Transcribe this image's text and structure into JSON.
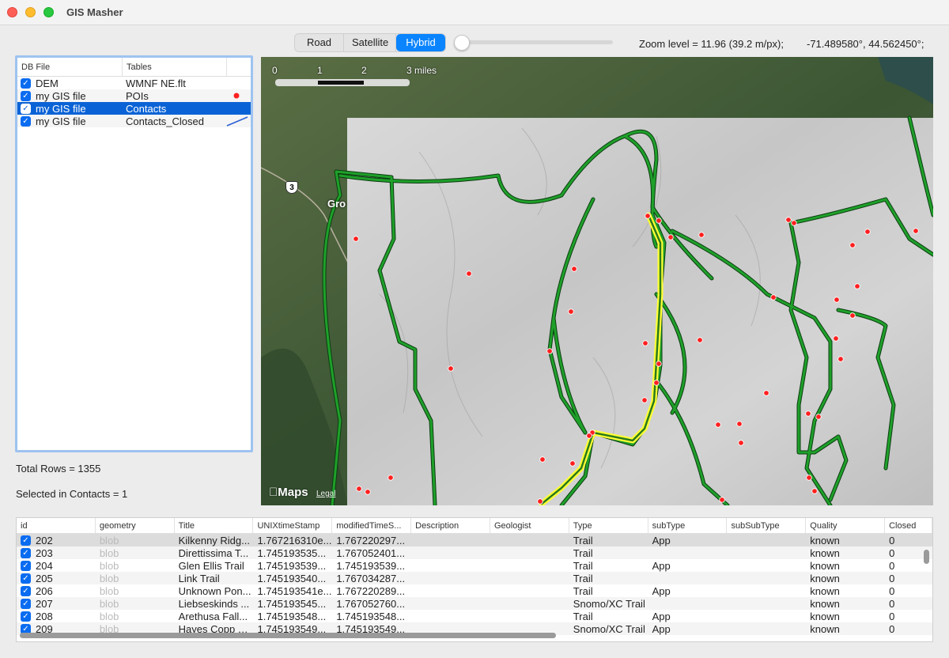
{
  "window": {
    "title": "GIS Masher"
  },
  "map_type": {
    "options": [
      "Road",
      "Satellite",
      "Hybrid"
    ],
    "selected": "Hybrid"
  },
  "zoom": {
    "label": "Zoom level = 11.96 (39.2 m/px);",
    "slider_fraction": 0.03
  },
  "coordinates": {
    "label": "-71.489580°, 44.562450°;"
  },
  "db_files": {
    "columns": [
      "DB File",
      "Tables"
    ],
    "rows": [
      {
        "file": "DEM",
        "table": "WMNF NE.flt",
        "checked": true,
        "selected": false,
        "symbol": "none"
      },
      {
        "file": "my GIS file",
        "table": "POIs",
        "checked": true,
        "selected": false,
        "symbol": "point"
      },
      {
        "file": "my GIS file",
        "table": "Contacts",
        "checked": true,
        "selected": true,
        "symbol": "none"
      },
      {
        "file": "my GIS file",
        "table": "Contacts_Closed",
        "checked": true,
        "selected": false,
        "symbol": "line"
      }
    ]
  },
  "stats": {
    "total_rows": "Total Rows = 1355",
    "selected": "Selected in Contacts = 1"
  },
  "map": {
    "scale_labels": [
      "0",
      "1",
      "2",
      "3 miles"
    ],
    "brand": "Maps",
    "legal": "Legal",
    "road_shield": "3",
    "town": "Gro",
    "colors": {
      "trail": "#1fa02a",
      "trail_outline": "#0b3d10",
      "highlight": "#ffff33",
      "poi": "#ff2020"
    }
  },
  "grid": {
    "columns": [
      "id",
      "geometry",
      "Title",
      "UNIXtimeStamp",
      "modifiedTimeS...",
      "Description",
      "Geologist",
      "Type",
      "subType",
      "subSubType",
      "Quality",
      "Closed"
    ],
    "rows": [
      {
        "id": "202",
        "geometry": "blob",
        "title": "Kilkenny Ridg...",
        "unix": "1.767216310e...",
        "mod": "1.767220297...",
        "desc": "",
        "geol": "",
        "type": "Trail",
        "sub": "App",
        "subsub": "",
        "quality": "known",
        "closed": "0"
      },
      {
        "id": "203",
        "geometry": "blob",
        "title": "Direttissima T...",
        "unix": "1.745193535...",
        "mod": "1.767052401...",
        "desc": "",
        "geol": "",
        "type": "Trail",
        "sub": "",
        "subsub": "",
        "quality": "known",
        "closed": "0"
      },
      {
        "id": "204",
        "geometry": "blob",
        "title": "Glen Ellis Trail",
        "unix": "1.745193539...",
        "mod": "1.745193539...",
        "desc": "",
        "geol": "",
        "type": "Trail",
        "sub": "App",
        "subsub": "",
        "quality": "known",
        "closed": "0"
      },
      {
        "id": "205",
        "geometry": "blob",
        "title": "Link Trail",
        "unix": "1.745193540...",
        "mod": "1.767034287...",
        "desc": "",
        "geol": "",
        "type": "Trail",
        "sub": "",
        "subsub": "",
        "quality": "known",
        "closed": "0"
      },
      {
        "id": "206",
        "geometry": "blob",
        "title": "Unknown Pon...",
        "unix": "1.745193541e...",
        "mod": "1.767220289...",
        "desc": "",
        "geol": "",
        "type": "Trail",
        "sub": "App",
        "subsub": "",
        "quality": "known",
        "closed": "0"
      },
      {
        "id": "207",
        "geometry": "blob",
        "title": "Liebseskinds ...",
        "unix": "1.745193545...",
        "mod": "1.767052760...",
        "desc": "",
        "geol": "",
        "type": "Snomo/XC Trail",
        "sub": "",
        "subsub": "",
        "quality": "known",
        "closed": "0"
      },
      {
        "id": "208",
        "geometry": "blob",
        "title": "Arethusa Fall...",
        "unix": "1.745193548...",
        "mod": "1.745193548...",
        "desc": "",
        "geol": "",
        "type": "Trail",
        "sub": "App",
        "subsub": "",
        "quality": "known",
        "closed": "0"
      },
      {
        "id": "209",
        "geometry": "blob",
        "title": "Hayes Copp Ya...",
        "unix": "1.745193549...",
        "mod": "1.745193549...",
        "desc": "",
        "geol": "",
        "type": "Snomo/XC Trail",
        "sub": "App",
        "subsub": "",
        "quality": "known",
        "closed": "0"
      }
    ]
  }
}
